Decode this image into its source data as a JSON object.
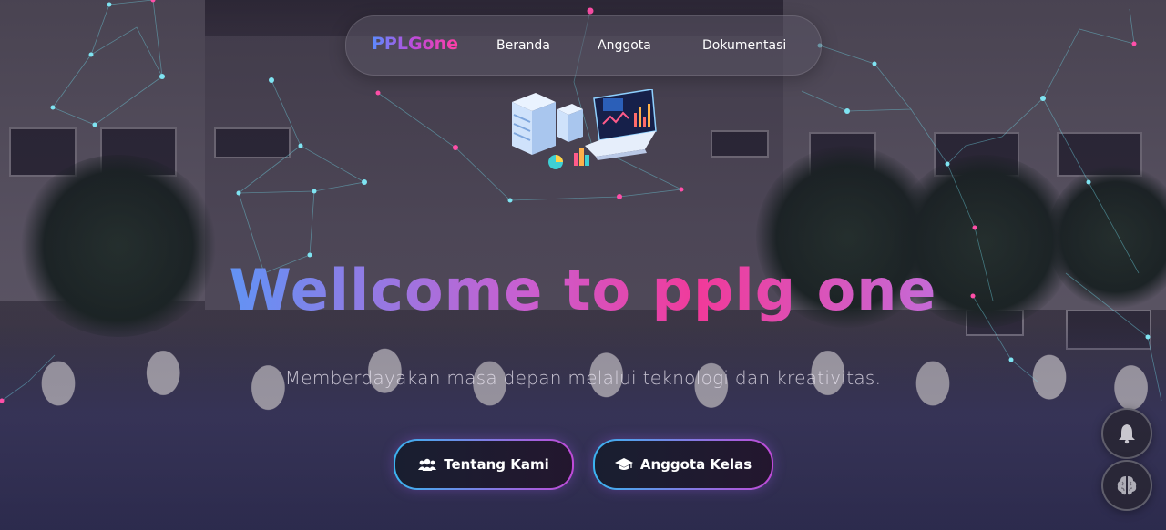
{
  "brand": {
    "name": "PPLGone"
  },
  "nav": {
    "links": [
      {
        "label": "Beranda"
      },
      {
        "label": "Anggota"
      },
      {
        "label": "Dokumentasi"
      }
    ]
  },
  "hero": {
    "title": "Wellcome to pplg one",
    "subtitle": "Memberdayakan masa depan melalui teknologi dan kreativitas.",
    "buttons": [
      {
        "label": "Tentang Kami",
        "icon": "users-icon"
      },
      {
        "label": "Anggota Kelas",
        "icon": "graduation-cap-icon"
      }
    ]
  },
  "floating": {
    "buttons": [
      {
        "icon": "bell-icon"
      },
      {
        "icon": "brain-icon"
      }
    ]
  },
  "colors": {
    "gradient_start": "#2bc0f0",
    "gradient_mid": "#f13a9a",
    "gradient_end": "#9d6cf0",
    "network_line": "#6fd6e6"
  }
}
